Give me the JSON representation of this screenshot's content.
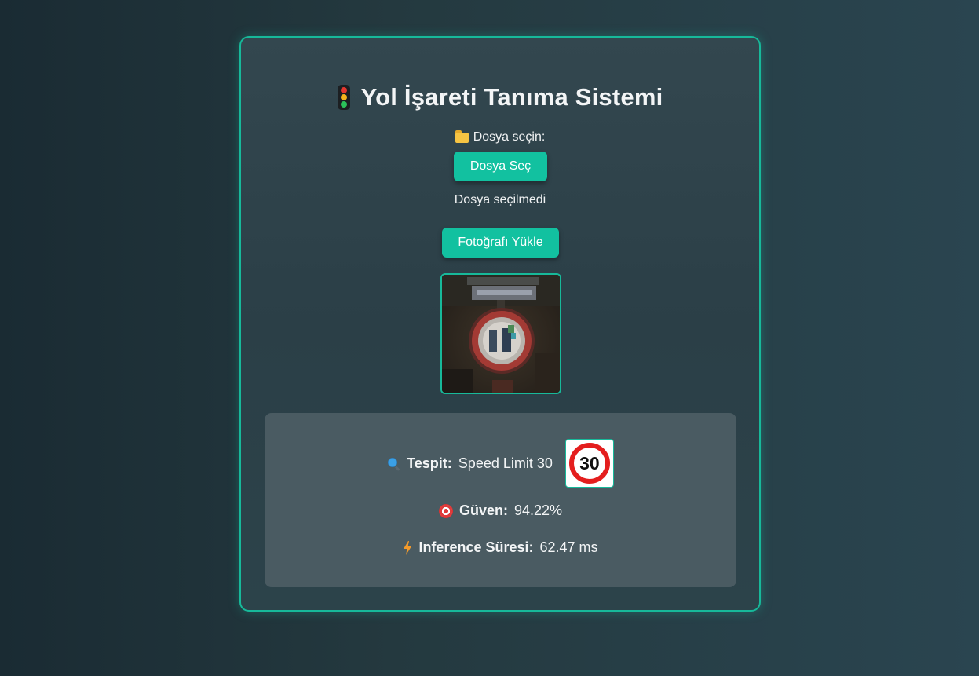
{
  "header": {
    "title": "Yol İşareti Tanıma Sistemi",
    "icon": "traffic-light-icon"
  },
  "upload": {
    "file_label": "Dosya seçin:",
    "choose_button": "Dosya Seç",
    "no_file_text": "Dosya seçilmedi",
    "upload_button": "Fotoğrafı Yükle"
  },
  "result": {
    "detect_label": "Tespit:",
    "detect_value": "Speed Limit 30",
    "sign_number": "30",
    "confidence_label": "Güven:",
    "confidence_value": "94.22%",
    "inference_label": "Inference Süresi:",
    "inference_value": "62.47 ms"
  },
  "colors": {
    "accent": "#12c1a0",
    "border": "#17b99a",
    "result_panel": "#4a5b62",
    "sign_red": "#e41e1e"
  }
}
